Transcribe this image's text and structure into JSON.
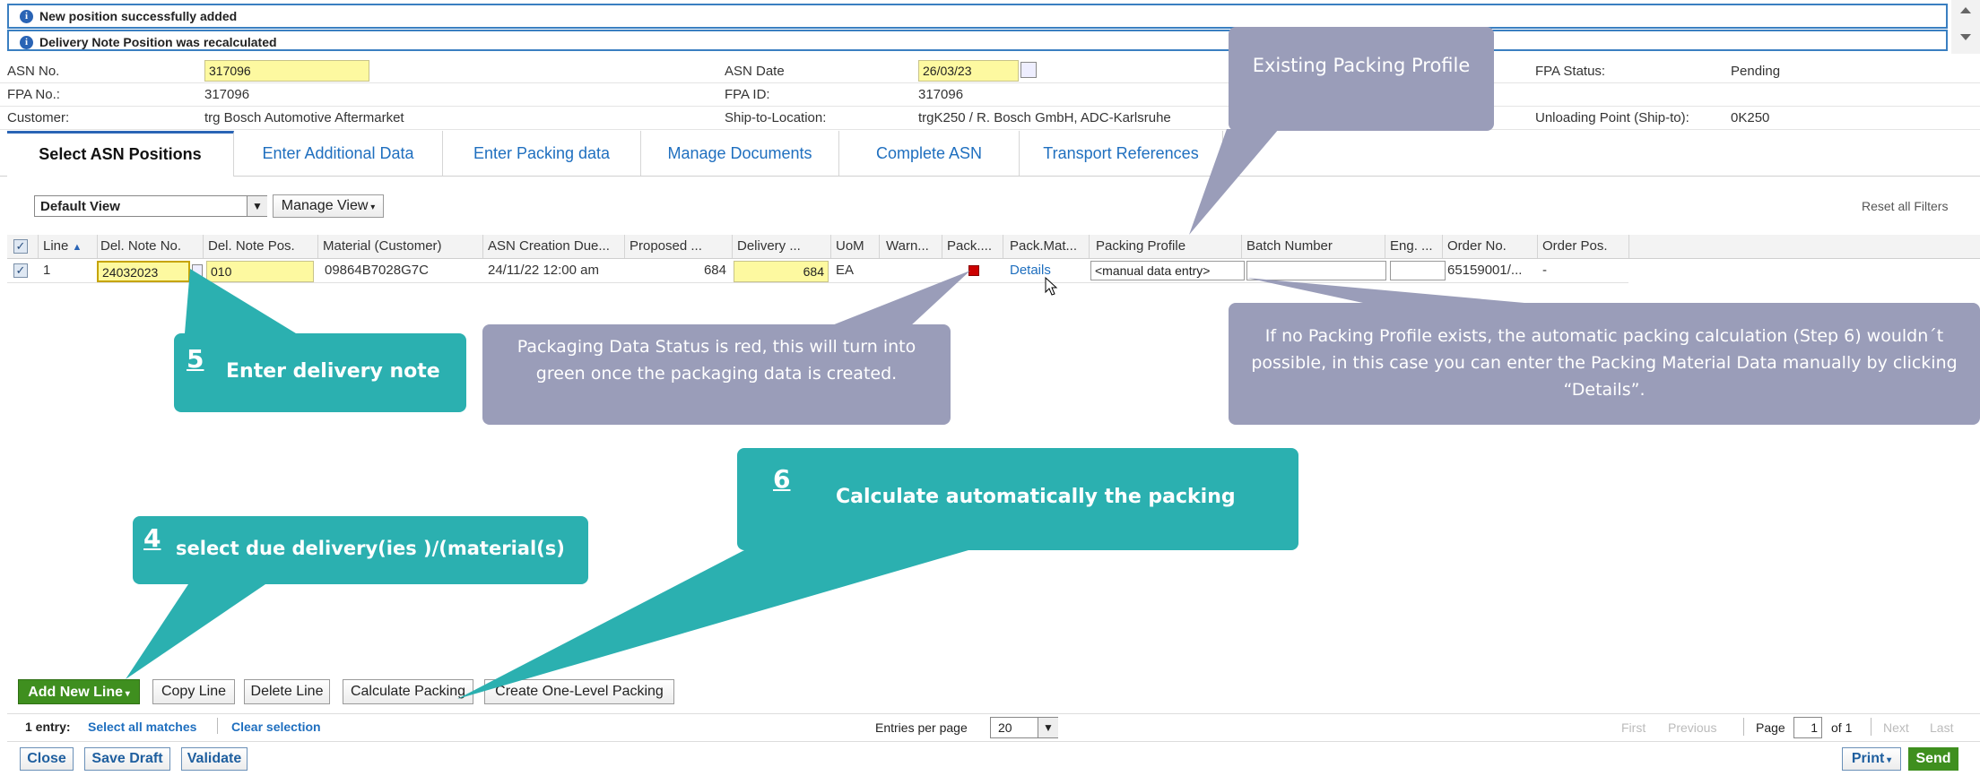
{
  "messages": [
    {
      "text": "New position successfully added"
    },
    {
      "text": "Delivery Note Position was recalculated"
    }
  ],
  "header": {
    "asn_no_label": "ASN No.",
    "asn_no_value": "317096",
    "asn_date_label": "ASN Date",
    "asn_date_value": "26/03/23",
    "fpa_status_label": "FPA Status:",
    "fpa_status_value": "Pending",
    "fpa_no_label": "FPA No.:",
    "fpa_no_value": "317096",
    "fpa_id_label": "FPA ID:",
    "fpa_id_value": "317096",
    "customer_label": "Customer:",
    "customer_value": "trg Bosch Automotive Aftermarket",
    "ship_to_label": "Ship-to-Location:",
    "ship_to_value": "trgK250 / R. Bosch GmbH, ADC-Karlsruhe",
    "unloading_label": "Unloading Point (Ship-to):",
    "unloading_value": "0K250"
  },
  "tabs": [
    {
      "label": "Select ASN Positions"
    },
    {
      "label": "Enter Additional Data"
    },
    {
      "label": "Enter Packing data"
    },
    {
      "label": "Manage Documents"
    },
    {
      "label": "Complete ASN"
    },
    {
      "label": "Transport References"
    }
  ],
  "view": {
    "selected": "Default View",
    "manage_label": "Manage View",
    "reset_filters": "Reset all Filters"
  },
  "grid": {
    "columns": [
      "Line",
      "Del. Note No.",
      "Del. Note Pos.",
      "Material (Customer)",
      "ASN Creation Due...",
      "Proposed ...",
      "Delivery ...",
      "UoM",
      "Warn...",
      "Pack....",
      "Pack.Mat...",
      "Packing Profile",
      "Batch Number",
      "Eng. ...",
      "Order No.",
      "Order Pos."
    ],
    "rows": [
      {
        "line": "1",
        "del_note_no": "24032023",
        "del_note_pos": "010",
        "material": "09864B7028G7C",
        "creation_due": "24/11/22 12:00 am",
        "proposed": "684",
        "delivery": "684",
        "uom": "EA",
        "pack_mat": "Details",
        "packing_profile": "<manual data entry>",
        "order_no": "65159001/...",
        "order_pos": "-"
      }
    ]
  },
  "actions": {
    "add_new_line": "Add New Line",
    "copy_line": "Copy Line",
    "delete_line": "Delete Line",
    "calculate_packing": "Calculate Packing",
    "create_one_level": "Create One-Level Packing"
  },
  "paging": {
    "entry_count": "1 entry:",
    "select_all": "Select all matches",
    "clear_selection": "Clear selection",
    "entries_label": "Entries per page",
    "entries_value": "20",
    "first": "First",
    "previous": "Previous",
    "page_label": "Page",
    "page_value": "1",
    "of_label": "of 1",
    "next": "Next",
    "last": "Last"
  },
  "footer": {
    "close": "Close",
    "save_draft": "Save Draft",
    "validate": "Validate",
    "print": "Print",
    "send": "Send"
  },
  "annotations": {
    "existing_profile": "Existing Packing Profile",
    "step5_num": "5",
    "step5_text": "Enter delivery note",
    "pack_status": "Packaging Data Status is red, this will turn into green once the packaging data is created.",
    "no_profile": "If no Packing Profile exists, the automatic packing calculation (Step 6) wouldn´t possible, in this case you can enter the Packing Material Data manually by clicking “Details”.",
    "step6_num": "6",
    "step6_text": "Calculate automatically the packing",
    "step4_num": "4",
    "step4_text": "select due delivery(ies )/(material(s)"
  },
  "colors": {
    "teal": "#2bb0b0",
    "gray_callout": "#9a9db9",
    "link_blue": "#1f6fbf",
    "send_green": "#3f8f1f",
    "field_yellow": "#fdf9a0",
    "status_red": "#cc0000"
  }
}
